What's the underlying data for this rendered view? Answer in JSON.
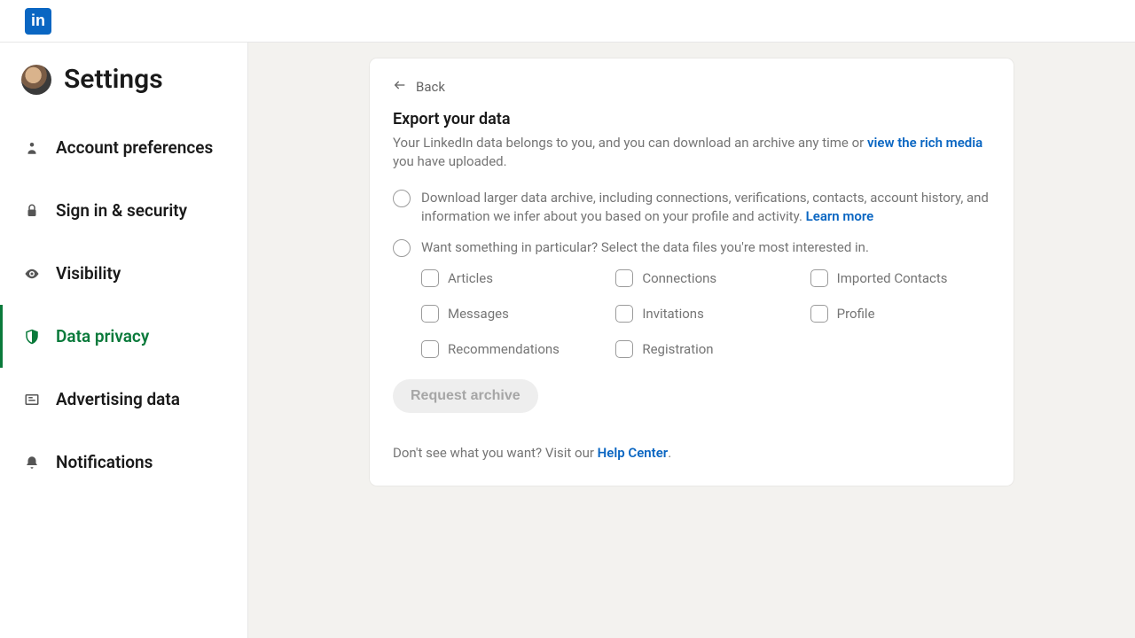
{
  "logo_text": "in",
  "sidebar": {
    "title": "Settings",
    "items": [
      {
        "label": "Account preferences"
      },
      {
        "label": "Sign in & security"
      },
      {
        "label": "Visibility"
      },
      {
        "label": "Data privacy"
      },
      {
        "label": "Advertising data"
      },
      {
        "label": "Notifications"
      }
    ]
  },
  "card": {
    "back": "Back",
    "title": "Export your data",
    "desc_prefix": "Your LinkedIn data belongs to you, and you can download an archive any time or ",
    "desc_link": "view the rich media",
    "desc_suffix": " you have uploaded.",
    "radio1_prefix": "Download larger data archive, including connections, verifications, contacts, account history, and information we infer about you based on your profile and activity. ",
    "radio1_link": "Learn more",
    "radio2": "Want something in particular? Select the data files you're most interested in.",
    "checkboxes": [
      "Articles",
      "Connections",
      "Imported Contacts",
      "Messages",
      "Invitations",
      "Profile",
      "Recommendations",
      "Registration"
    ],
    "request_btn": "Request archive",
    "footer_prefix": "Don't see what you want? Visit our ",
    "footer_link": "Help Center",
    "footer_suffix": "."
  }
}
